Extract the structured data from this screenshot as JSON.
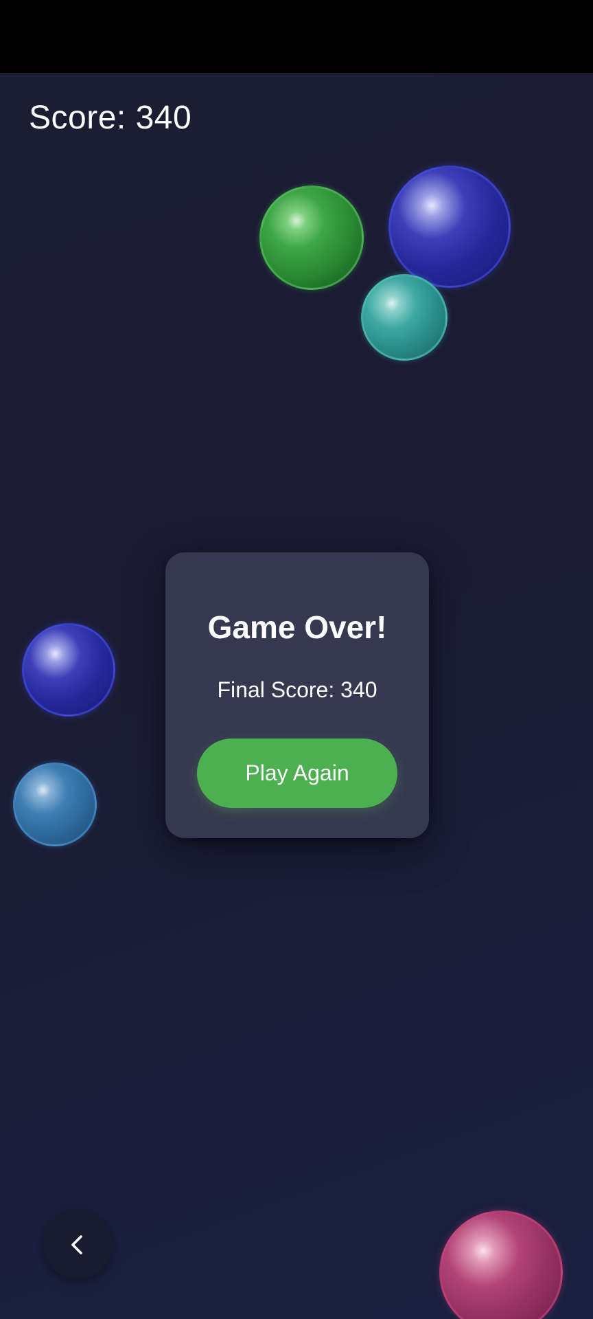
{
  "hud": {
    "score_text": "Score: 340"
  },
  "game_over_dialog": {
    "title": "Game Over!",
    "final_score_text": "Final Score: 340",
    "play_again_label": "Play Again"
  },
  "bubbles": [
    {
      "color": "green",
      "hex": "#2e8f37"
    },
    {
      "color": "navy-blue",
      "hex": "#27299c"
    },
    {
      "color": "teal",
      "hex": "#2a8d89"
    },
    {
      "color": "navy-blue",
      "hex": "#27299c"
    },
    {
      "color": "steel-blue",
      "hex": "#2e6a9c"
    },
    {
      "color": "magenta",
      "hex": "#963263"
    }
  ],
  "navigation": {
    "back_icon": "chevron-left-icon"
  },
  "colors": {
    "background": "#1b1d33",
    "status_bar": "#000000",
    "dialog_background": "#363850",
    "button_green": "#4caf50",
    "text": "#ffffff"
  }
}
